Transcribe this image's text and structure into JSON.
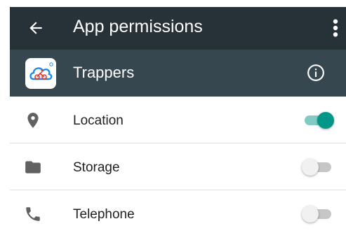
{
  "toolbar": {
    "title": "App permissions"
  },
  "app": {
    "name": "Trappers"
  },
  "permissions": [
    {
      "label": "Location",
      "enabled": true
    },
    {
      "label": "Storage",
      "enabled": false
    },
    {
      "label": "Telephone",
      "enabled": false
    }
  ],
  "colors": {
    "toolbar": "#263238",
    "app_header": "#37474f",
    "toggle_on": "#009688",
    "toggle_on_track": "#80cbc4",
    "toggle_off_track": "#c6c6c6",
    "icon_gray": "#616161",
    "app_icon_accent": "#1e88e5",
    "app_icon_rider": "#e53935"
  }
}
